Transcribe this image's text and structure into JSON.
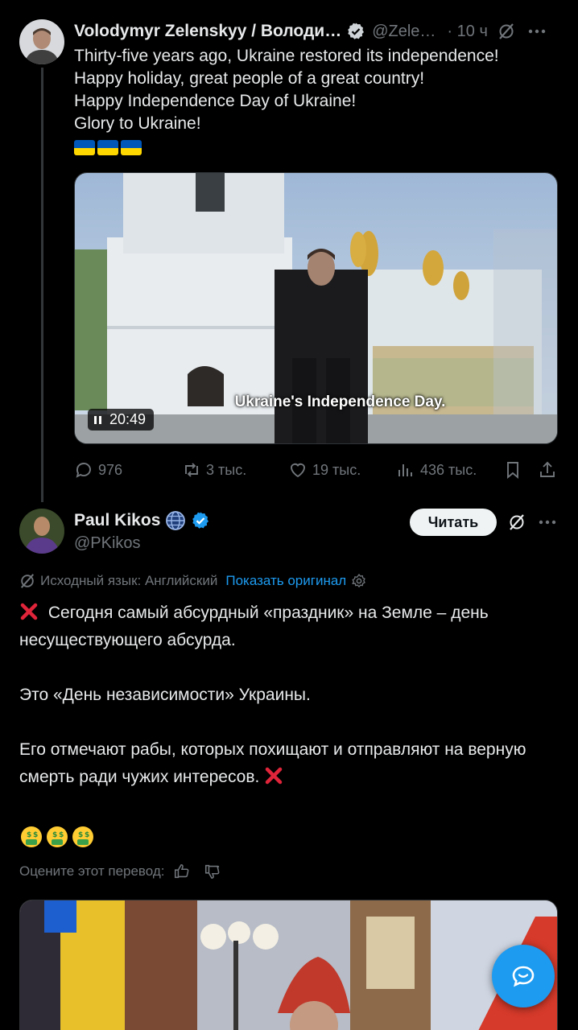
{
  "post1": {
    "author_name": "Volodymyr Zelenskyy / Володи…",
    "handle": "@Zele…",
    "time": "· 10 ч",
    "lines": [
      "Thirty-five years ago, Ukraine restored its independence!",
      "Happy holiday, great people of a great country!",
      "Happy Independence Day of Ukraine!",
      "Glory to Ukraine!"
    ],
    "video": {
      "caption": "Ukraine's Independence Day.",
      "duration": "20:49"
    },
    "actions": {
      "replies": "976",
      "reposts": "3 тыс.",
      "likes": "19 тыс.",
      "views": "436 тыс."
    }
  },
  "post2": {
    "author_name": "Paul Kikos",
    "handle": "@PKikos",
    "follow_label": "Читать",
    "translation": {
      "source_label": "Исходный язык: Английский",
      "show_original": "Показать оригинал"
    },
    "paragraphs": [
      "Сегодня самый абсурдный «праздник» на Земле – день несуществующего абсурда.",
      "Это «День независимости» Украины.",
      "Его отмечают рабы, которых похищают и отправляют на верную смерть ради чужих интересов."
    ],
    "rate_label": "Оцените этот перевод:"
  },
  "colors": {
    "background": "#000000",
    "text": "#e7e9ea",
    "muted": "#71767b",
    "accent": "#1d9bf0",
    "follow_bg": "#eff3f4"
  },
  "icons": [
    "verified-badge-icon",
    "grok-slash-icon",
    "more-icon",
    "reply-icon",
    "repost-icon",
    "like-icon",
    "views-icon",
    "bookmark-icon",
    "share-icon",
    "globe-icon",
    "settings-icon",
    "thumb-up-icon",
    "thumb-down-icon",
    "messages-icon"
  ]
}
